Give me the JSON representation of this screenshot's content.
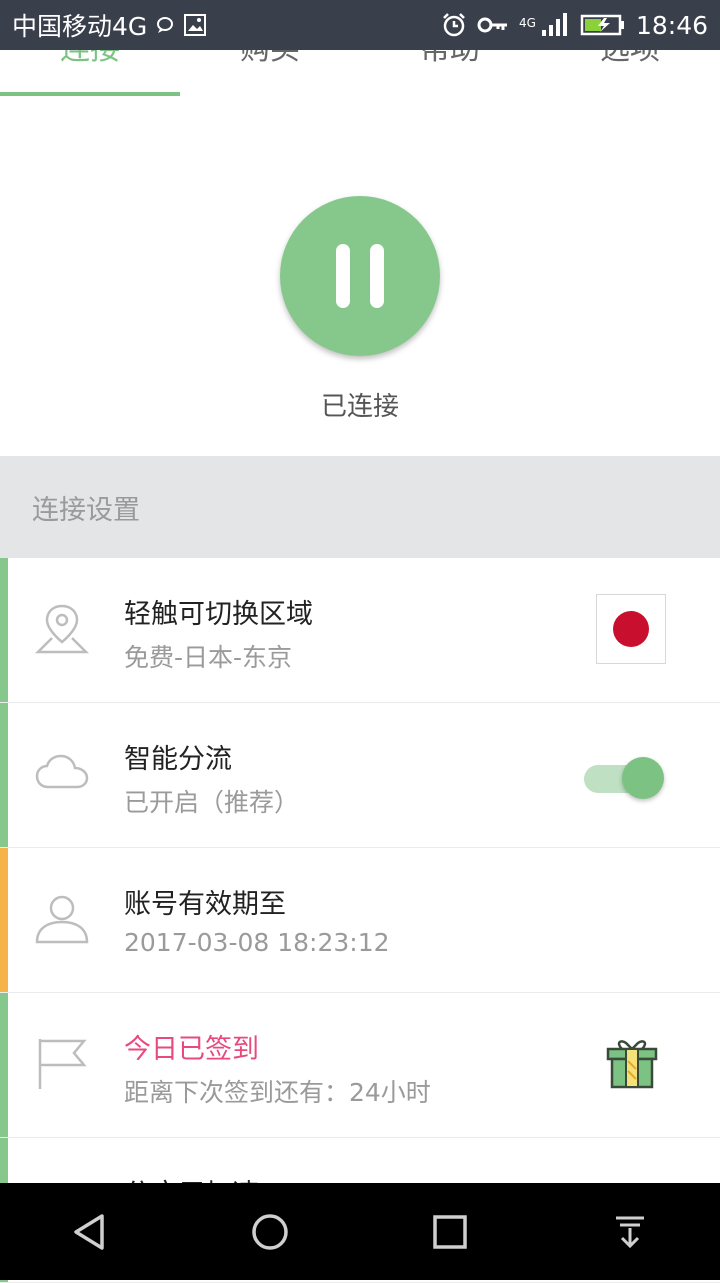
{
  "status_bar": {
    "carrier": "中国移动4G",
    "network_badge": "4G",
    "time": "18:46"
  },
  "tabs": [
    {
      "label": "连接",
      "active": true
    },
    {
      "label": "购买",
      "active": false
    },
    {
      "label": "帮助",
      "active": false
    },
    {
      "label": "选项",
      "active": false
    }
  ],
  "connection": {
    "status": "已连接"
  },
  "section": {
    "title": "连接设置"
  },
  "rows": [
    {
      "title": "轻触可切换区域",
      "subtitle": "免费-日本-东京",
      "accent": "#86c88c",
      "icon": "location-pin-icon",
      "trailing": "japan-flag"
    },
    {
      "title": "智能分流",
      "subtitle": "已开启（推荐）",
      "accent": "#86c88c",
      "icon": "cloud-icon",
      "trailing": "toggle",
      "toggle_on": true
    },
    {
      "title": "账号有效期至",
      "subtitle": "2017-03-08 18:23:12",
      "accent": "#f6b34a",
      "icon": "user-icon"
    },
    {
      "title": "今日已签到",
      "subtitle": "距离下次签到还有：24小时",
      "accent": "#86c88c",
      "icon": "flag-icon",
      "trailing": "gift"
    },
    {
      "title": "分应用加速",
      "accent": "#86c88c",
      "icon": "apps-icon"
    }
  ],
  "colors": {
    "accent_green": "#7cc383",
    "accent_orange": "#f6b34a",
    "checkin_pink": "#e84a7e",
    "status_bar": "#3a3f4c"
  }
}
